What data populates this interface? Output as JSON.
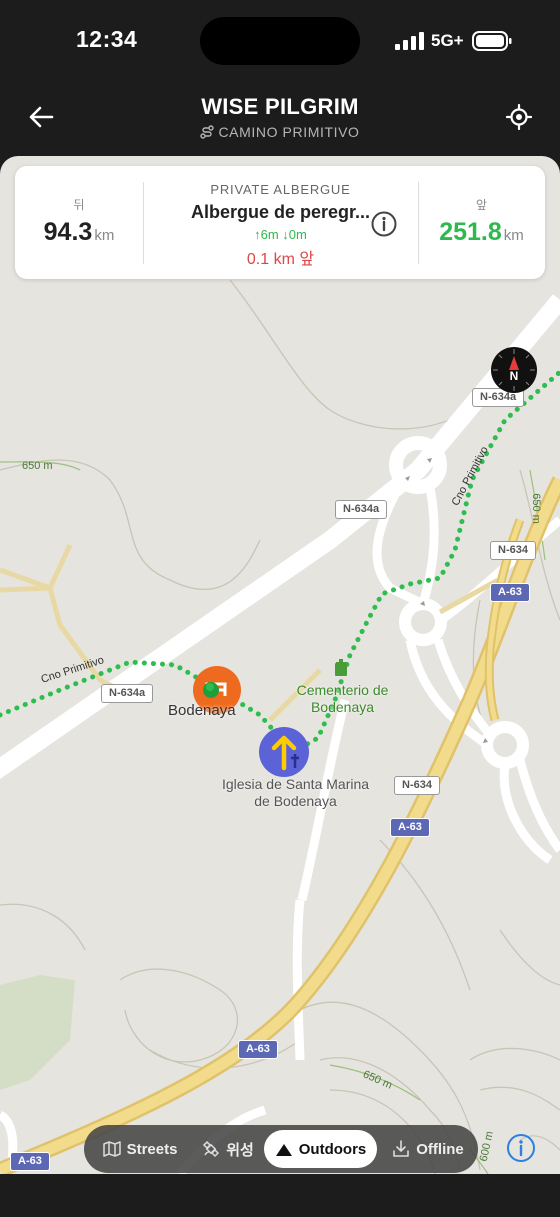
{
  "status_bar": {
    "time": "12:34",
    "network": "5G+"
  },
  "header": {
    "title": "WISE PILGRIM",
    "subtitle": "CAMINO PRIMITIVO"
  },
  "info_card": {
    "behind_label": "뒤",
    "behind_value": "94.3",
    "behind_unit": "km",
    "type": "PRIVATE ALBERGUE",
    "name": "Albergue de peregr...",
    "elevation": "↑6m ↓0m",
    "distance": "0.1 km 앞",
    "ahead_label": "앞",
    "ahead_value": "251.8",
    "ahead_unit": "km"
  },
  "map": {
    "labels": {
      "bodenaya": "Bodenaya",
      "cementerio": "Cementerio de Bodenaya",
      "iglesia": "Iglesia de Santa Marina de Bodenaya",
      "camino1": "Cno Primitivo",
      "camino2": "Cno Primitivo",
      "contour_650a": "650 m",
      "contour_650b": "650 m",
      "contour_650c": "650 m",
      "contour_600": "600 m"
    },
    "road_badges": {
      "n634a_1": "N-634a",
      "n634a_2": "N-634a",
      "n634a_3": "N-634a",
      "n634_1": "N-634",
      "n634_2": "N-634",
      "a63_1": "A-63",
      "a63_2": "A-63",
      "a63_3": "A-63",
      "a63_4": "A-63"
    },
    "compass_label": "N"
  },
  "layers": {
    "streets": "Streets",
    "satellite": "위성",
    "outdoors": "Outdoors",
    "offline": "Offline",
    "active": "outdoors"
  },
  "colors": {
    "route": "#2ebd4f",
    "motorway": "#e8c96a",
    "accent_green": "#2eb84e",
    "accent_red": "#e04646",
    "albergue_orange": "#ee6a1e",
    "church_blue": "#5b63d6"
  }
}
